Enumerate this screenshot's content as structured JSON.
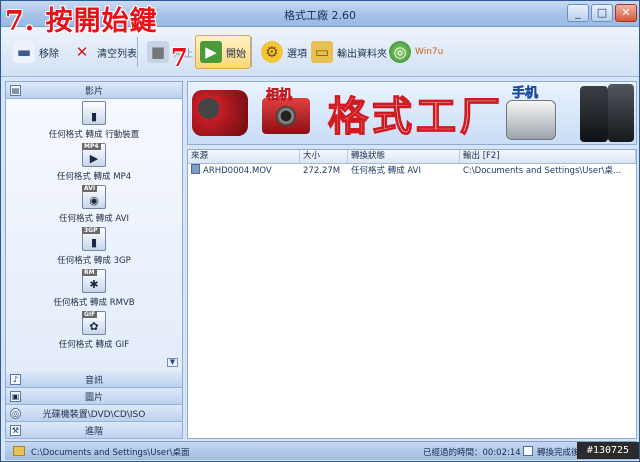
{
  "window": {
    "title": "格式工廠 2.60",
    "min": "_",
    "max": "□",
    "close": "✕"
  },
  "annotation": {
    "text": "7. 按開始鍵",
    "toolbar_marker": "7"
  },
  "toolbar": {
    "items": [
      {
        "label": "移除",
        "icon": "remove-icon"
      },
      {
        "label": "清空列表",
        "icon": "clear-list-icon"
      },
      {
        "label": "停止",
        "icon": "stop-icon"
      },
      {
        "label": "開始",
        "icon": "start-icon"
      },
      {
        "label": "選項",
        "icon": "options-icon"
      },
      {
        "label": "輸出資料夾",
        "icon": "output-folder-icon"
      },
      {
        "label": "Win7u",
        "icon": "win7-icon"
      }
    ]
  },
  "sidebar": {
    "video_header": "影片",
    "video_items": [
      {
        "label": "任何格式 轉成 行動裝置",
        "badge": "",
        "glyph": "▮"
      },
      {
        "label": "任何格式 轉成 MP4",
        "badge": "MP4",
        "glyph": "▶"
      },
      {
        "label": "任何格式 轉成 AVI",
        "badge": "AVI",
        "glyph": "◉"
      },
      {
        "label": "任何格式 轉成 3GP",
        "badge": "3GP",
        "glyph": "▮"
      },
      {
        "label": "任何格式 轉成 RMVB",
        "badge": "RM",
        "glyph": "✱"
      },
      {
        "label": "任何格式 轉成 GIF",
        "badge": "GIF",
        "glyph": "✿"
      }
    ],
    "other_headers": [
      "音訊",
      "圖片",
      "光碟機裝置\\DVD\\CD\\ISO",
      "進階"
    ]
  },
  "banner": {
    "camera_tag": "相机",
    "headline": "格式工厂",
    "phone_tag": "手机"
  },
  "task_list": {
    "columns": [
      "來源",
      "大小",
      "轉換狀態",
      "輸出 [F2]"
    ],
    "rows": [
      {
        "source": "ARHD0004.MOV",
        "size": "272.27M",
        "status": "任何格式 轉成 AVI",
        "output": "C:\\Documents and Settings\\User\\桌..."
      }
    ]
  },
  "statusbar": {
    "output_path": "C:\\Documents and Settings\\User\\桌面",
    "elapsed": "已經過的時間：00:02:14",
    "after_done": "轉換完成後：關閉電腦"
  },
  "watermark": "#130725",
  "colors": {
    "accent": "#e8101a",
    "frame": "#2d5a97",
    "panel": "#e8f0fb"
  }
}
